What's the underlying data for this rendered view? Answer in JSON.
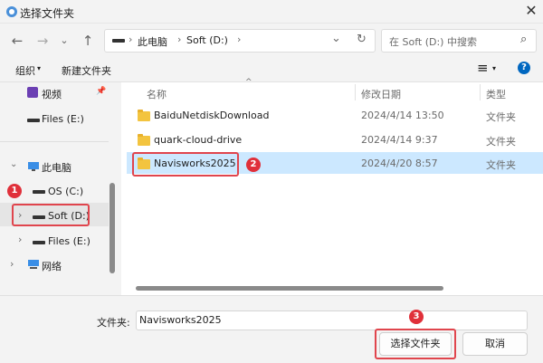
{
  "window": {
    "title": "选择文件夹",
    "close_glyph": "✕"
  },
  "nav": {
    "back_glyph": "←",
    "forward_glyph": "→",
    "recent_glyph": "⌄",
    "up_glyph": "↑",
    "breadcrumb": [
      "此电脑",
      "Soft (D:)"
    ],
    "crumb_sep": "›",
    "dropdown_glyph": "⌄",
    "refresh_glyph": "↻",
    "search_placeholder": "在 Soft (D:) 中搜索",
    "search_glyph": "⌕"
  },
  "toolbar": {
    "organize": "组织",
    "organize_caret": "▾",
    "new_folder": "新建文件夹",
    "view_glyph": "≡",
    "view_caret": "▾",
    "help_glyph": "?"
  },
  "sidebar": {
    "items": [
      {
        "label": "视频",
        "icon": "video-icon",
        "pin": "📌"
      },
      {
        "label": "Files (E:)",
        "icon": "drive-icon"
      },
      {
        "label": "此电脑",
        "icon": "computer-icon",
        "expander": "⌄"
      },
      {
        "label": "OS (C:)",
        "icon": "drive-icon"
      },
      {
        "label": "Soft (D:)",
        "icon": "drive-icon",
        "expander": "›",
        "selected": true
      },
      {
        "label": "Files (E:)",
        "icon": "drive-icon",
        "expander": "›"
      },
      {
        "label": "网络",
        "icon": "network-icon",
        "expander": "›"
      }
    ]
  },
  "columns": {
    "name": "名称",
    "date": "修改日期",
    "type": "类型",
    "sort_glyph": "^"
  },
  "files": [
    {
      "name": "BaiduNetdiskDownload",
      "date": "2024/4/14 13:50",
      "type": "文件夹"
    },
    {
      "name": "quark-cloud-drive",
      "date": "2024/4/14 9:37",
      "type": "文件夹"
    },
    {
      "name": "Navisworks2025",
      "date": "2024/4/20 8:57",
      "type": "文件夹",
      "selected": true
    }
  ],
  "footer": {
    "folder_label": "文件夹:",
    "folder_value": "Navisworks2025",
    "select_button": "选择文件夹",
    "cancel_button": "取消"
  },
  "annotations": {
    "badge1": "1",
    "badge2": "2",
    "badge3": "3"
  },
  "colors": {
    "accent": "#0067c0",
    "selection": "#cce8ff",
    "highlight": "#e0454d",
    "folder": "#f3c43f"
  }
}
